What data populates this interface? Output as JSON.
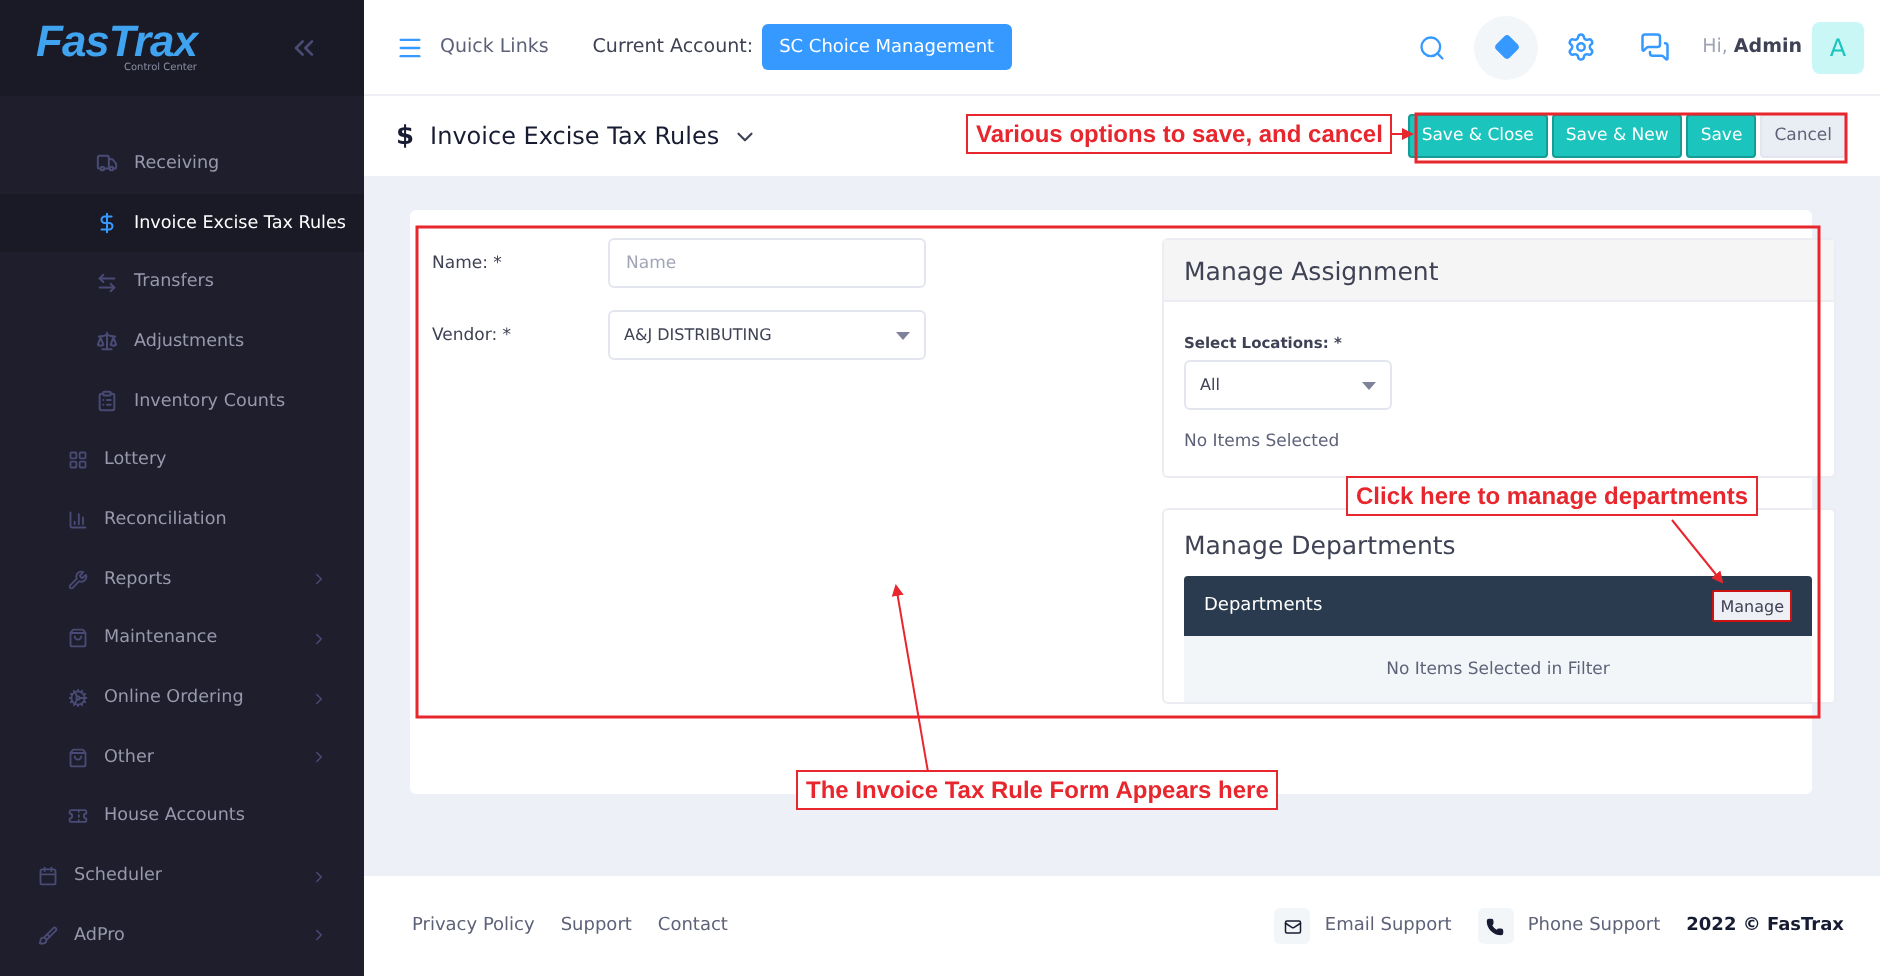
{
  "sidebar": {
    "logo": {
      "name": "FasTrax",
      "tagline": "Control Center"
    },
    "items": [
      {
        "children": [
          {
            "children": [
              {
                "label": "Receiving",
                "selected": false,
                "has_submenu": false
              },
              {
                "label": "Invoice Excise Tax Rules",
                "selected": true,
                "has_submenu": false
              },
              {
                "label": "Transfers",
                "selected": false,
                "has_submenu": false
              },
              {
                "label": "Adjustments",
                "selected": false,
                "has_submenu": false
              },
              {
                "label": "Inventory Counts",
                "selected": false,
                "has_submenu": false
              }
            ]
          },
          {
            "label": "Lottery",
            "selected": false,
            "has_submenu": false
          },
          {
            "label": "Reconciliation",
            "selected": false,
            "has_submenu": false
          },
          {
            "label": "Reports",
            "selected": false,
            "has_submenu": true
          },
          {
            "label": "Maintenance",
            "selected": false,
            "has_submenu": true
          },
          {
            "label": "Online Ordering",
            "selected": false,
            "has_submenu": true
          },
          {
            "label": "Other",
            "selected": false,
            "has_submenu": true
          },
          {
            "label": "House Accounts",
            "selected": false,
            "has_submenu": false
          }
        ]
      },
      {
        "label": "Scheduler",
        "selected": false,
        "has_submenu": true
      },
      {
        "label": "AdPro",
        "selected": false,
        "has_submenu": true
      }
    ]
  },
  "header": {
    "quick_links": "Quick Links",
    "account_label": "Current Account:",
    "account": "SC Choice Management",
    "greeting": "Hi,",
    "user": "Admin",
    "avatar": "A"
  },
  "page": {
    "icon_text": "$",
    "title": "Invoice Excise Tax Rules",
    "buttons": [
      {
        "label": "Save & Close",
        "kind": "primary"
      },
      {
        "label": "Save & New",
        "kind": "primary"
      },
      {
        "label": "Save",
        "kind": "primary"
      },
      {
        "label": "Cancel",
        "kind": "secondary"
      }
    ]
  },
  "form": {
    "fields": [
      {
        "label": "Name: *",
        "kind": "text",
        "placeholder": "Name"
      },
      {
        "label": "Vendor: *",
        "kind": "select",
        "value": "A&J DISTRIBUTING"
      }
    ]
  },
  "assignment": {
    "title": "Manage Assignment",
    "locations_label": "Select Locations: *",
    "locations_value": "All",
    "empty": "No Items Selected"
  },
  "departments": {
    "title": "Manage Departments",
    "bar_title": "Departments",
    "manage": "Manage",
    "empty": "No Items Selected in Filter"
  },
  "annotations": [
    {
      "text": "Various options to save, and cancel"
    },
    {
      "text": "Click here to manage departments"
    },
    {
      "text": "The Invoice Tax Rule Form Appears here"
    }
  ],
  "footer": {
    "links": [
      "Privacy Policy",
      "Support",
      "Contact"
    ],
    "email": "Email Support",
    "phone": "Phone Support",
    "copyright": "2022 © FasTrax"
  }
}
